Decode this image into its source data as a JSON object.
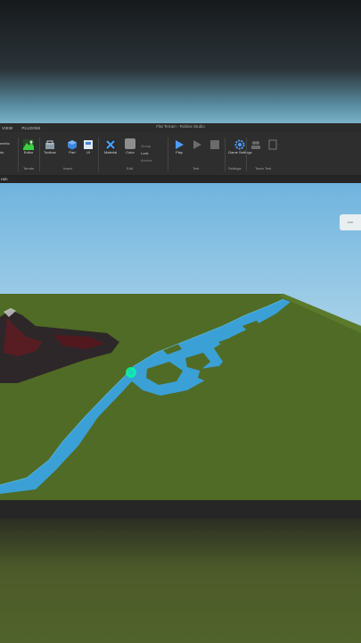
{
  "window": {
    "title": "Flat Terrain - Roblox Studio"
  },
  "menu": {
    "tabs": [
      "VIEW",
      "PLUGINS"
    ]
  },
  "ribbon": {
    "left_partial": [
      "metric",
      "ds"
    ],
    "tools": {
      "editor": "Editor",
      "toolbox": "Toolbox",
      "part": "Part",
      "ui": "UI",
      "material": "Material",
      "color": "Color",
      "play": "Play",
      "game_settings": "Game Settings",
      "group_label": "Group",
      "lock_label": "Lock",
      "anchor_label": "Anchor"
    },
    "groups": {
      "terrain": "Terrain",
      "insert": "Insert",
      "edit": "Edit",
      "test": "Test",
      "settings": "Settings",
      "team_test": "Team Test"
    }
  },
  "subbar": {
    "label": "rain"
  },
  "viewport": {
    "side_button": "sun"
  },
  "colors": {
    "water": "#3aa0d6",
    "grass": "#4f6b25",
    "rock": "#2d2729",
    "lava": "#7a1b20",
    "accent": "#00ff9c"
  }
}
